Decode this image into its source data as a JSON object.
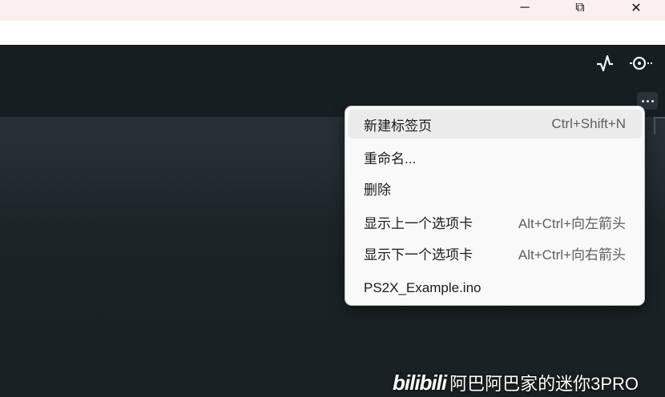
{
  "window_controls": {
    "minimize_glyph": "─",
    "restore_glyph": "⧉",
    "close_glyph": "✕"
  },
  "toolbar": {
    "icons": [
      "pulse-icon",
      "serial-monitor-icon",
      "more-icon"
    ]
  },
  "context_menu": {
    "items": [
      {
        "label": "新建标签页",
        "shortcut": "Ctrl+Shift+N",
        "highlighted": true
      },
      {
        "label": "重命名...",
        "shortcut": ""
      },
      {
        "label": "删除",
        "shortcut": ""
      },
      {
        "label": "显示上一个选项卡",
        "shortcut": "Alt+Ctrl+向左箭头"
      },
      {
        "label": "显示下一个选项卡",
        "shortcut": "Alt+Ctrl+向右箭头"
      },
      {
        "label": "PS2X_Example.ino",
        "shortcut": ""
      }
    ]
  },
  "watermark": {
    "logo": "bilibili",
    "text": "阿巴阿巴家的迷你3PRO"
  }
}
